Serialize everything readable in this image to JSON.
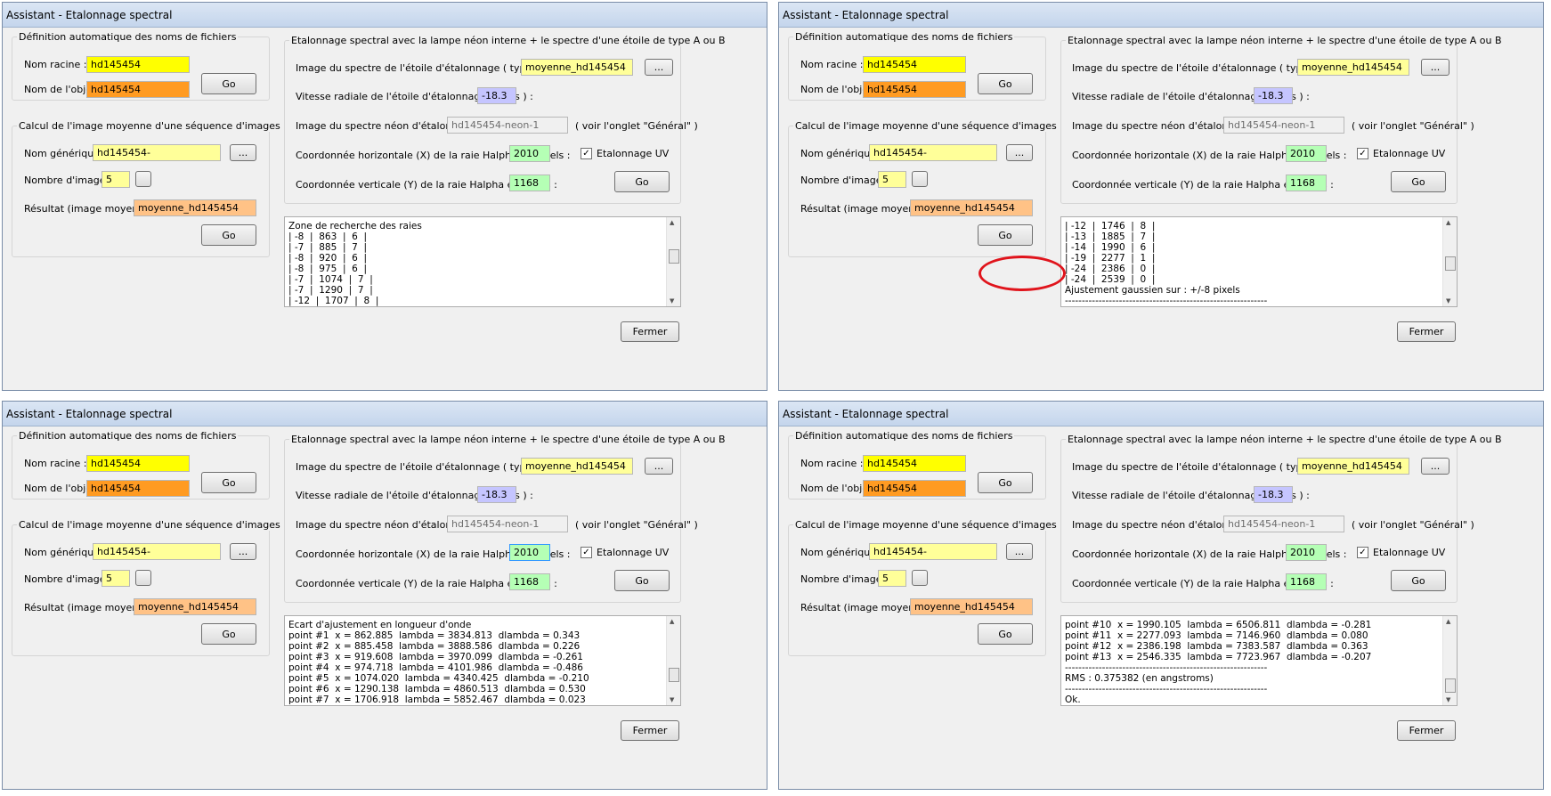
{
  "window_title": "Assistant - Etalonnage spectral",
  "left_group": {
    "naming_title": "Définition automatique des noms de fichiers",
    "nom_racine_label": "Nom racine :",
    "nom_racine_value": "hd145454",
    "nom_objet_label": "Nom de l'objet :",
    "nom_objet_value": "hd145454",
    "go_label": "Go",
    "average_title": "Calcul de l'image moyenne d'une séquence d'images",
    "nom_generique_label": "Nom générique :",
    "nom_generique_value": "hd145454-",
    "browse_label": "...",
    "nombre_label": "Nombre d'images :",
    "nombre_value": "5",
    "resultat_label": "Résultat (image moyenne) :",
    "resultat_value": "moyenne_hd145454"
  },
  "right_group": {
    "title": "Etalonnage spectral avec la lampe néon interne + le spectre d'une étoile de type A ou B",
    "image_etoile_label": "Image du spectre de l'étoile d'étalonnage ( type A ou B ) :",
    "image_etoile_value": "moyenne_hd145454",
    "browse_label": "...",
    "vitesse_label": "Vitesse radiale de l'étoile d'étalonnage ( km/s ) :",
    "vitesse_value": "-18.3",
    "neon_label": "Image du spectre néon d'étalonnage :",
    "neon_value": "hd145454-neon-1",
    "neon_note": "( voir l'onglet \"Général\" )",
    "coord_x_label": "Coordonnée horizontale (X) de la raie Halpha en pixels :",
    "coord_x_value": "2010",
    "uv_label": "Etalonnage UV",
    "uv_check": "✓",
    "coord_y_label": "Coordonnée verticale (Y) de la raie Halpha en pixels :",
    "coord_y_value": "1168",
    "go_label": "Go"
  },
  "fermer_label": "Fermer",
  "logs": {
    "panel1": [
      "Zone de recherche des raies",
      "| -8  |  863  |  6  |",
      "| -7  |  885  |  7  |",
      "| -8  |  920  |  6  |",
      "| -8  |  975  |  6  |",
      "| -7  |  1074  |  7  |",
      "| -7  |  1290  |  7  |",
      "| -12  |  1707  |  8  |"
    ],
    "panel2": [
      "| -12  |  1746  |  8  |",
      "| -13  |  1885  |  7  |",
      "| -14  |  1990  |  6  |",
      "| -19  |  2277  |  1  |",
      "| -24  |  2386  |  0  |",
      "| -24  |  2539  |  0  |",
      "Ajustement gaussien sur : +/-8 pixels",
      "------------------------------------------------------------"
    ],
    "panel3": [
      "Ecart d'ajustement en longueur d'onde",
      "point #1  x = 862.885  lambda = 3834.813  dlambda = 0.343",
      "point #2  x = 885.458  lambda = 3888.586  dlambda = 0.226",
      "point #3  x = 919.608  lambda = 3970.099  dlambda = -0.261",
      "point #4  x = 974.718  lambda = 4101.986  dlambda = -0.486",
      "point #5  x = 1074.020  lambda = 4340.425  dlambda = -0.210",
      "point #6  x = 1290.138  lambda = 4860.513  dlambda = 0.530",
      "point #7  x = 1706.918  lambda = 5852.467  dlambda = 0.023"
    ],
    "panel4": [
      "point #10  x = 1990.105  lambda = 6506.811  dlambda = -0.281",
      "point #11  x = 2277.093  lambda = 7146.960  dlambda = 0.080",
      "point #12  x = 2386.198  lambda = 7383.587  dlambda = 0.363",
      "point #13  x = 2546.335  lambda = 7723.967  dlambda = -0.207",
      "------------------------------------------------------------",
      "RMS : 0.375382 (en angstroms)",
      "------------------------------------------------------------",
      "Ok."
    ]
  },
  "colors": {
    "nom_racine": "#ffff00",
    "nom_objet": "#ff9b22",
    "nom_generique": "#ffff99",
    "resultat": "#ffc286",
    "vitesse": "#c5c5ff",
    "coords": "#b5ffb5",
    "highlight_circle": "#e0141c"
  }
}
